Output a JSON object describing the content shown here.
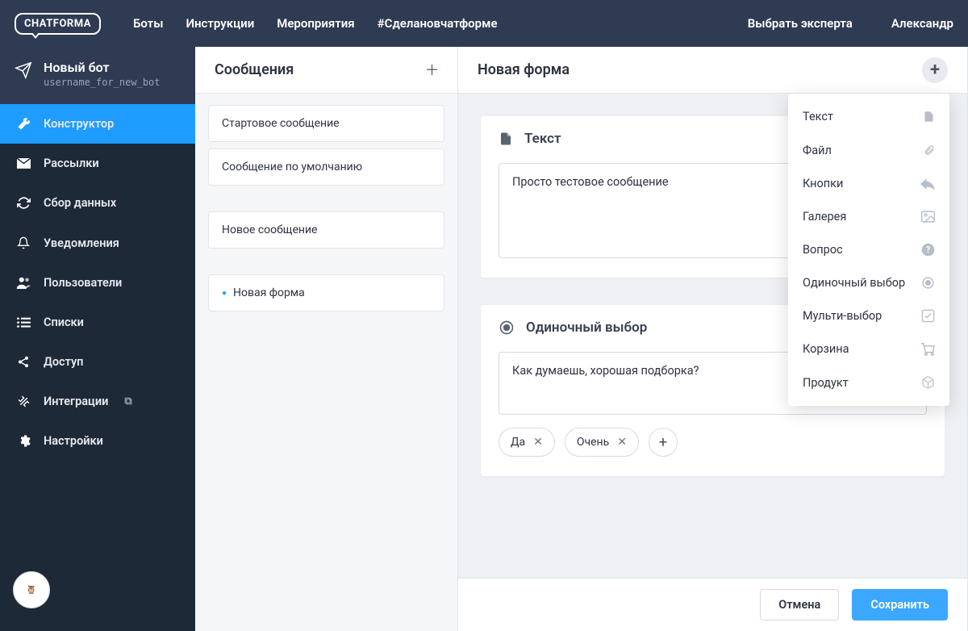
{
  "brand": "CHATFORMA",
  "topnav": {
    "links": [
      "Боты",
      "Инструкции",
      "Мероприятия",
      "#Сделановчатформе"
    ],
    "expert": "Выбрать эксперта",
    "user": "Александр"
  },
  "bot": {
    "title": "Новый бот",
    "username": "username_for_new_bot"
  },
  "sidebar": {
    "items": [
      {
        "label": "Конструктор",
        "icon": "wrench-icon",
        "active": true
      },
      {
        "label": "Рассылки",
        "icon": "mail-icon"
      },
      {
        "label": "Сбор данных",
        "icon": "refresh-icon"
      },
      {
        "label": "Уведомления",
        "icon": "bell-icon"
      },
      {
        "label": "Пользователи",
        "icon": "users-icon"
      },
      {
        "label": "Списки",
        "icon": "list-icon"
      },
      {
        "label": "Доступ",
        "icon": "share-icon"
      },
      {
        "label": "Интеграции",
        "icon": "plug-icon",
        "ext": true
      },
      {
        "label": "Настройки",
        "icon": "gear-icon"
      }
    ]
  },
  "messages": {
    "title": "Сообщения",
    "groups": [
      [
        "Стартовое сообщение",
        "Сообщение по умолчанию"
      ],
      [
        "Новое сообщение"
      ],
      [
        "Новая форма"
      ]
    ],
    "selected": "Новая форма"
  },
  "form": {
    "title": "Новая форма",
    "blocks": [
      {
        "type": "text",
        "title": "Текст",
        "value": "Просто тестовое сообщение"
      },
      {
        "type": "single",
        "title": "Одиночный выбор",
        "value": "Как думаешь, хорошая подборка?",
        "options": [
          "Да",
          "Очень"
        ]
      }
    ]
  },
  "dropdown": {
    "items": [
      {
        "label": "Текст",
        "icon": "doc-icon"
      },
      {
        "label": "Файл",
        "icon": "attach-icon"
      },
      {
        "label": "Кнопки",
        "icon": "reply-icon"
      },
      {
        "label": "Галерея",
        "icon": "image-icon"
      },
      {
        "label": "Вопрос",
        "icon": "help-icon"
      },
      {
        "label": "Одиночный выбор",
        "icon": "radio-icon"
      },
      {
        "label": "Мульти-выбор",
        "icon": "check-icon"
      },
      {
        "label": "Корзина",
        "icon": "cart-icon"
      },
      {
        "label": "Продукт",
        "icon": "box-icon"
      }
    ]
  },
  "footer": {
    "cancel": "Отмена",
    "save": "Сохранить"
  }
}
